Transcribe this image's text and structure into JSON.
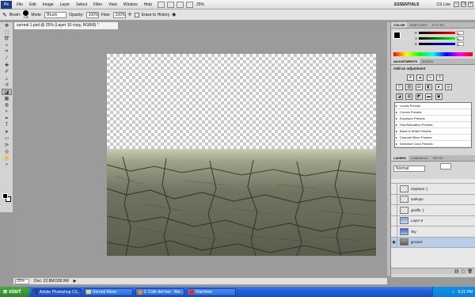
{
  "menu": {
    "logo": "Ps",
    "items": [
      "File",
      "Edit",
      "Image",
      "Layer",
      "Select",
      "Filter",
      "View",
      "Window",
      "Help"
    ],
    "zoom": "25%",
    "workspace": "ESSENTIALS",
    "cs_live": "CS Live"
  },
  "options_bar": {
    "brush_label": "Brush:",
    "brush_size": "125",
    "mode_label": "Mode:",
    "mode_value": "Brush",
    "opacity_label": "Opacity:",
    "opacity_value": "100%",
    "flow_label": "Flow:",
    "flow_value": "100%",
    "history_label": "Erase to History"
  },
  "document": {
    "tab_title": "surreal 1.psd @ 25% (Layer 10 copy, RGB/8) *",
    "zoom": "25%",
    "doc_info": "Doc: 22.8M/338.9M"
  },
  "panels": {
    "color_tabs": [
      "COLOR",
      "SWATCHES",
      "STYLES"
    ],
    "color_channels": [
      "R",
      "G",
      "B"
    ],
    "color_values": [
      "0",
      "0",
      "0"
    ],
    "adjust_tabs": [
      "ADJUSTMENTS",
      "MASKS"
    ],
    "adjust_title": "Add an adjustment",
    "presets": [
      "Levels Presets",
      "Curves Presets",
      "Exposure Presets",
      "Hue/Saturation Presets",
      "Black & White Presets",
      "Channel Mixer Presets",
      "Selective Color Presets"
    ],
    "layer_tabs": [
      "LAYERS",
      "CHANNELS",
      "PATHS"
    ],
    "blend_mode": "Normal",
    "layers": [
      "elephant :)",
      "antilope",
      "giraffe :)",
      "Layer 9",
      "sky",
      "ground"
    ]
  },
  "taskbar": {
    "start": "start",
    "tasks": [
      "Adobe Photoshop CS...",
      "Surreal Music",
      "2. Cafe del mar - Bor...",
      "IrfanView"
    ],
    "clock": "9:31 PM"
  },
  "colors": {
    "accent_blue": "#245edb",
    "start_green": "#2e8a2c"
  }
}
